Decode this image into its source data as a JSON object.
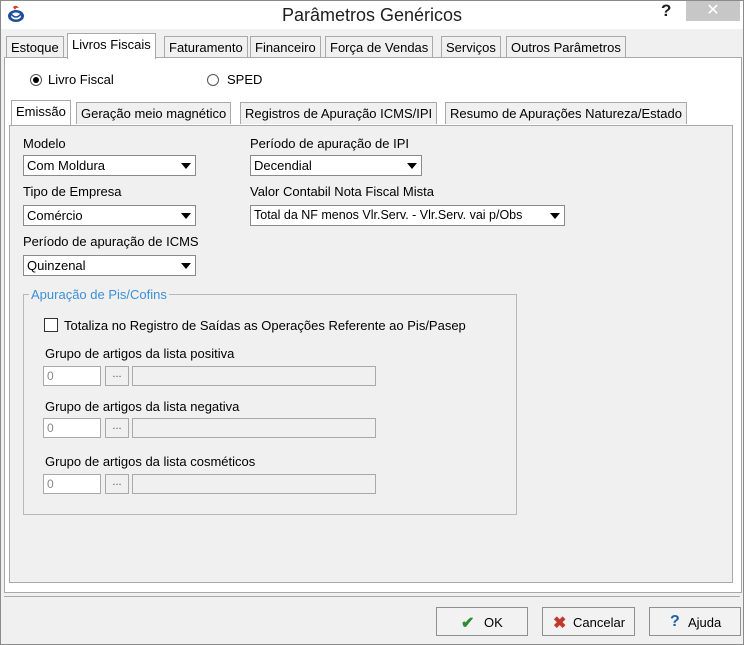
{
  "window": {
    "title": "Parâmetros Genéricos",
    "help_glyph": "?",
    "close_glyph": "✕"
  },
  "main_tabs": [
    {
      "label": "Estoque"
    },
    {
      "label": "Livros Fiscais"
    },
    {
      "label": "Faturamento"
    },
    {
      "label": "Financeiro"
    },
    {
      "label": "Força de Vendas"
    },
    {
      "label": "Serviços"
    },
    {
      "label": "Outros Parâmetros"
    }
  ],
  "book_type": {
    "options": [
      {
        "label": "Livro Fiscal",
        "checked": true
      },
      {
        "label": "SPED",
        "checked": false
      }
    ]
  },
  "sub_tabs": [
    {
      "label": "Emissão"
    },
    {
      "label": "Geração meio magnético"
    },
    {
      "label": "Registros de Apuração ICMS/IPI"
    },
    {
      "label": "Resumo de Apurações Natureza/Estado"
    }
  ],
  "fields": {
    "modelo": {
      "label": "Modelo",
      "value": "Com Moldura"
    },
    "tipo_empresa": {
      "label": "Tipo de Empresa",
      "value": "Comércio"
    },
    "periodo_icms": {
      "label": "Período de apuração de ICMS",
      "value": "Quinzenal"
    },
    "periodo_ipi": {
      "label": "Período de apuração de IPI",
      "value": "Decendial"
    },
    "valor_contabil": {
      "label": "Valor Contabil Nota Fiscal Mista",
      "value": "Total da NF menos Vlr.Serv. - Vlr.Serv. vai p/Obs"
    }
  },
  "pis_cofins": {
    "title": "Apuração de Pis/Cofins",
    "totaliza_label": "Totaliza no Registro de Saídas as Operações Referente ao Pis/Pasep",
    "totaliza_checked": false,
    "groups": [
      {
        "label": "Grupo de artigos da lista positiva",
        "code": "0",
        "button": "...",
        "description": ""
      },
      {
        "label": "Grupo de artigos da lista negativa",
        "code": "0",
        "button": "...",
        "description": ""
      },
      {
        "label": "Grupo de artigos da lista cosméticos",
        "code": "0",
        "button": "...",
        "description": ""
      }
    ]
  },
  "buttons": {
    "ok": "OK",
    "cancel": "Cancelar",
    "help": "Ajuda"
  },
  "colors": {
    "group_title": "#3b8fd6",
    "ok_icon": "#2e8b2e",
    "cancel_icon": "#c0392b",
    "help_icon": "#1f5fa8"
  }
}
